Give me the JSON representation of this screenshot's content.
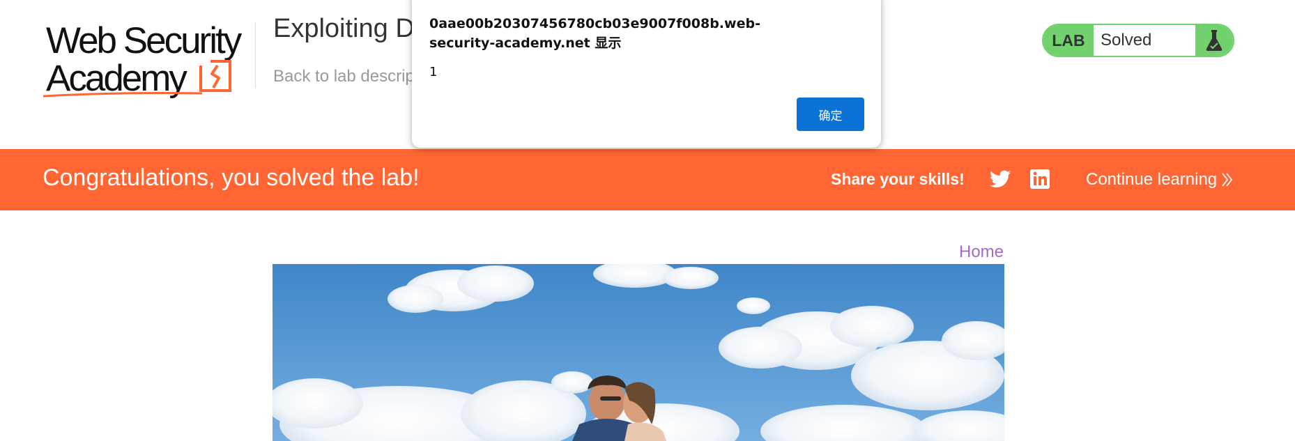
{
  "header": {
    "logo": {
      "line1": "Web Security",
      "line2": "Academy"
    },
    "lab_title": "Exploiting DO",
    "back_link": "Back to lab descrip",
    "lab_status": {
      "label": "LAB",
      "state": "Solved",
      "icon": "flask-icon"
    }
  },
  "banner": {
    "message": "Congratulations, you solved the lab!",
    "share_label": "Share your skills!",
    "share_icons": [
      "twitter-icon",
      "linkedin-icon"
    ],
    "continue_label": "Continue learning"
  },
  "main": {
    "home_link": "Home"
  },
  "dialog": {
    "origin": "0aae00b20307456780cb03e9007f008b.web-security-academy.net 显示",
    "message": "1",
    "ok_label": "确定"
  },
  "colors": {
    "brand_orange": "#ff6633",
    "solved_green": "#70d16d",
    "dialog_button_blue": "#0b72d6",
    "home_link_purple": "#a06bc7"
  }
}
